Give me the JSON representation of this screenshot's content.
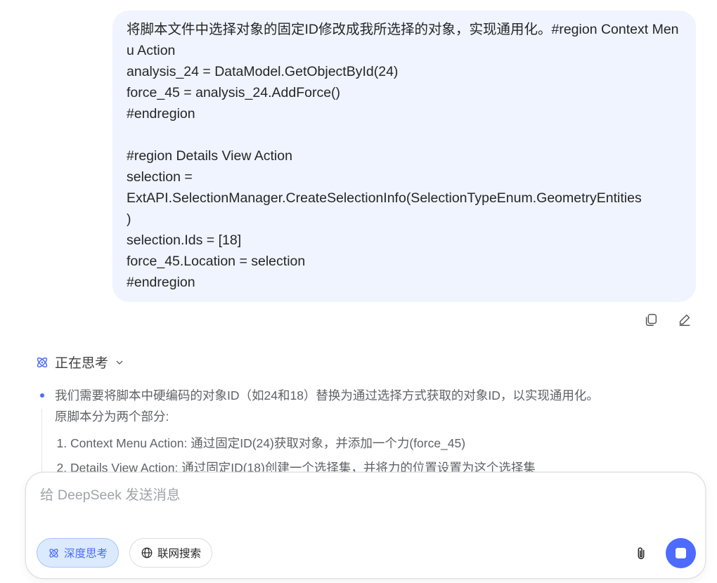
{
  "user_message": {
    "text": "将脚本文件中选择对象的固定ID修改成我所选择的对象，实现通用化。#region Context Menu Action\nanalysis_24 = DataModel.GetObjectById(24)\nforce_45 = analysis_24.AddForce()\n#endregion\n\n#region Details View Action\nselection =\nExtAPI.SelectionManager.CreateSelectionInfo(SelectionTypeEnum.GeometryEntities\n)\nselection.Ids = [18]\nforce_45.Location = selection\n#endregion"
  },
  "message_actions": {
    "copy_icon": "copy-icon",
    "edit_icon": "edit-icon"
  },
  "thinking": {
    "status_label": "正在思考",
    "icon": "atom-icon",
    "chevron": "chevron-down-icon",
    "paragraph_1": "我们需要将脚本中硬编码的对象ID（如24和18）替换为通过选择方式获取的对象ID，以实现通用化。",
    "paragraph_2": "原脚本分为两个部分:",
    "steps": [
      "Context Menu Action: 通过固定ID(24)获取对象，并添加一个力(force_45)",
      "Details View Action: 通过固定ID(18)创建一个选择集，并将力的位置设置为这个选择集"
    ]
  },
  "composer": {
    "placeholder": "给 DeepSeek 发送消息",
    "value": "",
    "deep_think_label": "深度思考",
    "deep_think_active": true,
    "web_search_label": "联网搜索",
    "web_search_active": false,
    "attach_icon": "paperclip-icon",
    "stop_icon": "stop-icon"
  },
  "colors": {
    "accent": "#4d6bfe",
    "bubble_bg": "#eff4ff",
    "deep_think_bg": "#dbeafe"
  }
}
